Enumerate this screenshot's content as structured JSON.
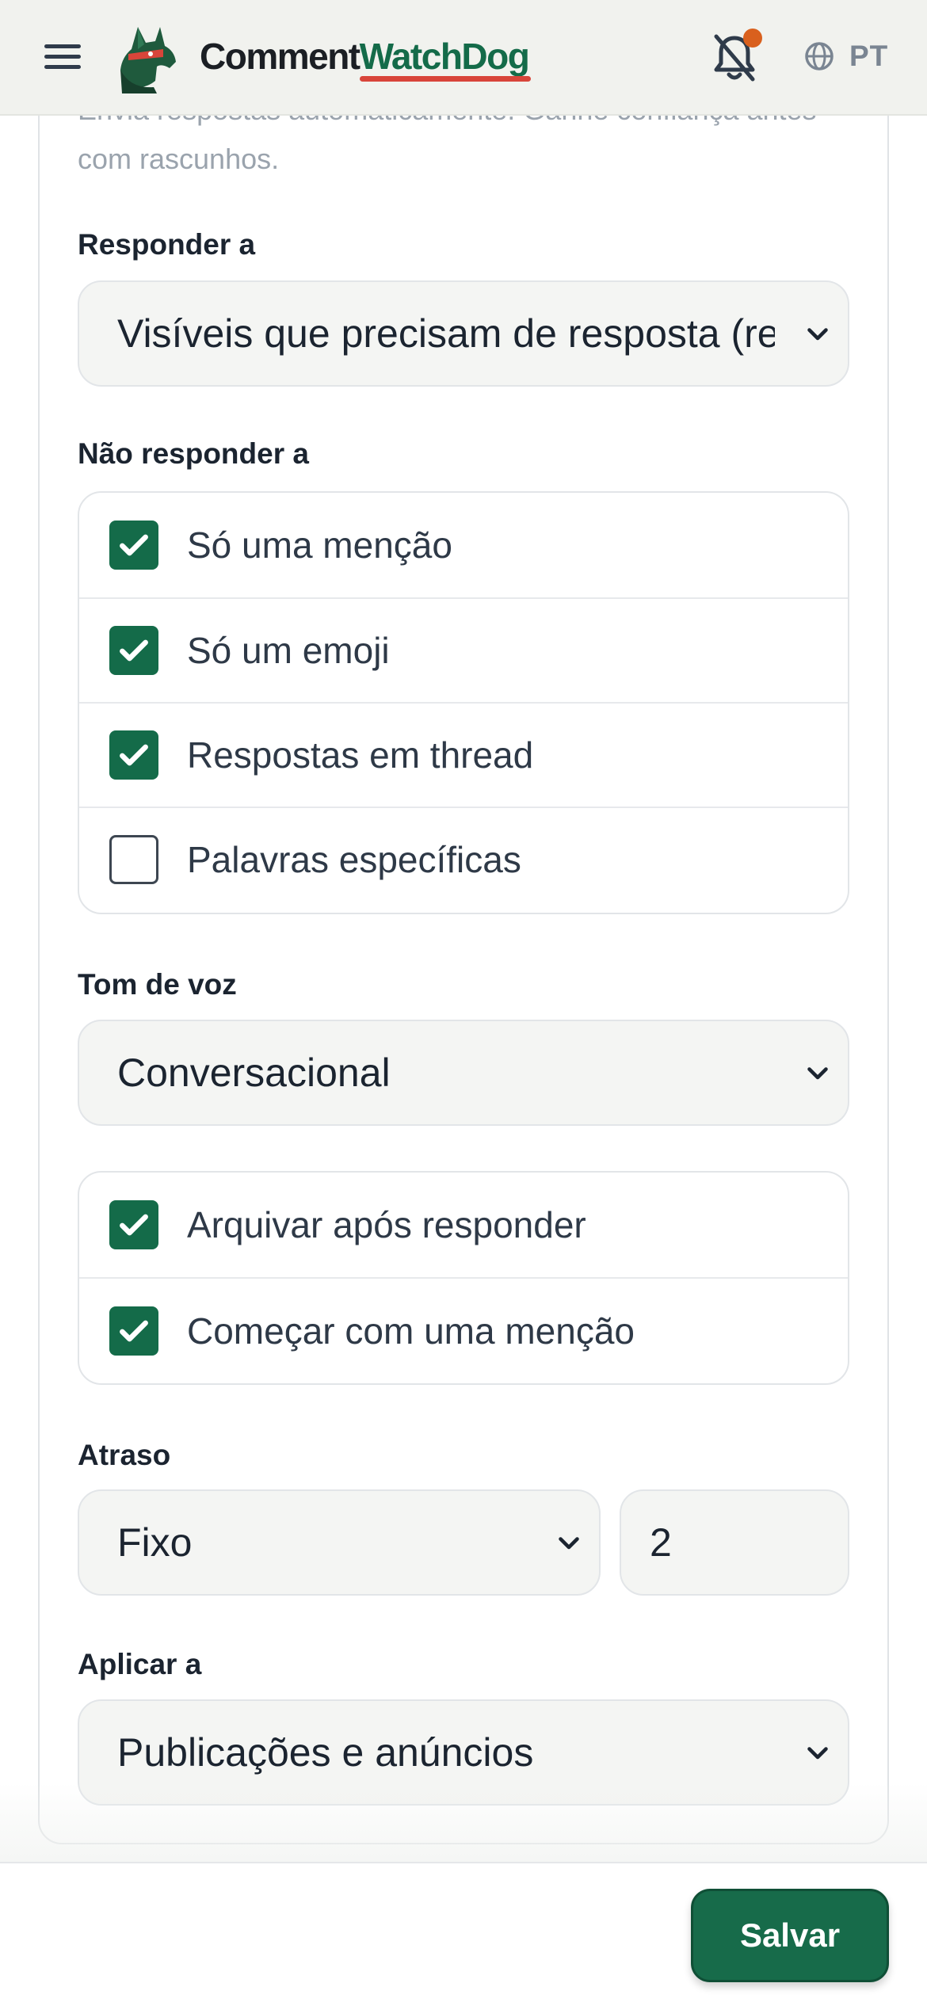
{
  "header": {
    "brand_part1": "Comment",
    "brand_part2": "WatchDog",
    "language": "PT",
    "has_notification": true,
    "colors": {
      "brand_green": "#146b49",
      "underline": "#d8453a",
      "notification_dot": "#d9601d"
    }
  },
  "form": {
    "description": "Envia respostas automaticamente. Ganhe confiança antes com rascunhos.",
    "reply_to": {
      "label": "Responder a",
      "value": "Visíveis que precisam de resposta (recomendado)"
    },
    "do_not_reply": {
      "label": "Não responder a",
      "options": [
        {
          "label": "Só uma menção",
          "checked": true
        },
        {
          "label": "Só um emoji",
          "checked": true
        },
        {
          "label": "Respostas em thread",
          "checked": true
        },
        {
          "label": "Palavras específicas",
          "checked": false
        }
      ]
    },
    "tone": {
      "label": "Tom de voz",
      "value": "Conversacional"
    },
    "extra_options": [
      {
        "label": "Arquivar após responder",
        "checked": true
      },
      {
        "label": "Começar com uma menção",
        "checked": true
      }
    ],
    "delay": {
      "label": "Atraso",
      "mode": "Fixo",
      "amount": "2"
    },
    "apply_to": {
      "label": "Aplicar a",
      "value": "Publicações e anúncios"
    }
  },
  "footer": {
    "save_label": "Salvar",
    "accent": "#176b4a"
  }
}
